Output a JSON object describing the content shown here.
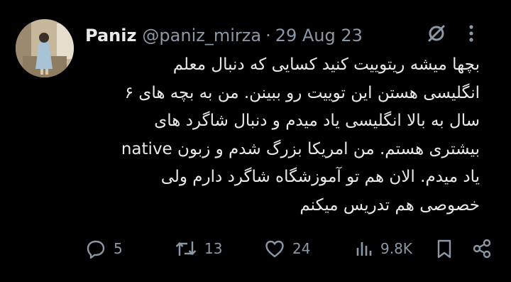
{
  "tweet": {
    "author": {
      "name": "Paniz",
      "handle": "@paniz_mirza",
      "separator": "·",
      "date": "29 Aug 23"
    },
    "header_icons": [
      "grok-icon",
      "more-vertical-icon"
    ],
    "text_lines": [
      "بچها میشه ریتوییت کنید کسایی که دنبال معلم",
      "انگلیسی هستن این توییت رو ببینن. من به بچه های ۶",
      "سال به بالا انگلیسی یاد میدم و دنبال شاگرد های",
      "بیشتری هستم. من امریکا بزرگ شدم و زبون native",
      "یاد میدم. الان هم تو آموزشگاه شاگرد دارم ولی",
      "خصوصی هم تدریس میکنم"
    ],
    "actions": {
      "replies": "5",
      "retweets": "13",
      "likes": "24",
      "views": "9.8K"
    },
    "action_icons": [
      "reply-icon",
      "retweet-icon",
      "like-icon",
      "views-icon",
      "bookmark-icon",
      "share-icon"
    ]
  },
  "colors": {
    "background": "#000000",
    "text_primary": "#e7e9ea",
    "text_secondary": "#8b98a5"
  }
}
